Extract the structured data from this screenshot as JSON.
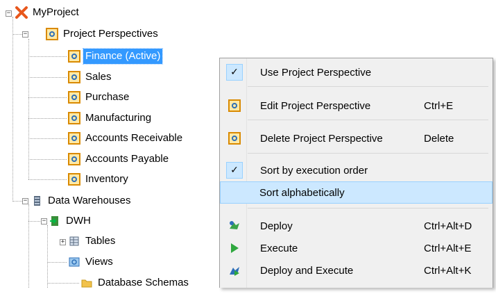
{
  "tree": {
    "root": "MyProject",
    "perspectives": {
      "label": "Project Perspectives",
      "items": [
        "Finance (Active)",
        "Sales",
        "Purchase",
        "Manufacturing",
        "Accounts Receivable",
        "Accounts Payable",
        "Inventory"
      ]
    },
    "data_warehouses": "Data Warehouses",
    "dwh": {
      "label": "DWH",
      "children": [
        "Tables",
        "Views",
        "Database Schemas"
      ]
    }
  },
  "context_menu": {
    "use_perspective": "Use Project Perspective",
    "edit_perspective": "Edit Project Perspective",
    "edit_shortcut": "Ctrl+E",
    "delete_perspective": "Delete Project Perspective",
    "delete_shortcut": "Delete",
    "sort_execution": "Sort by execution order",
    "sort_alpha": "Sort alphabetically",
    "deploy": "Deploy",
    "deploy_shortcut": "Ctrl+Alt+D",
    "execute": "Execute",
    "execute_shortcut": "Ctrl+Alt+E",
    "deploy_execute": "Deploy and Execute",
    "deploy_execute_shortcut": "Ctrl+Alt+K"
  },
  "colors": {
    "selection": "#3399ff",
    "hover": "#cce8ff",
    "accent": "#d98a00"
  }
}
